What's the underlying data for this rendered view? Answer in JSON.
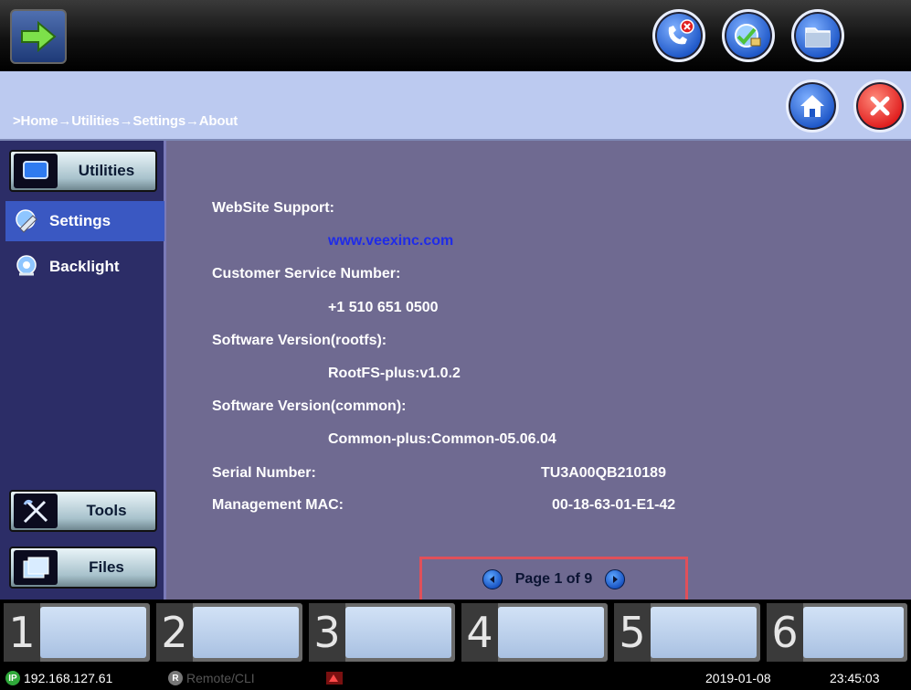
{
  "breadcrumb": ">Home→Utilities→Settings→About",
  "sidebar": {
    "top_button": "Utilities",
    "items": [
      {
        "label": "Settings",
        "active": true
      },
      {
        "label": "Backlight",
        "active": false
      }
    ],
    "bottom_buttons": [
      "Tools",
      "Files"
    ]
  },
  "about": {
    "website_label": "WebSite Support:",
    "website_value": "www.veexinc.com",
    "customer_label": "Customer Service Number:",
    "customer_value": "+1 510 651 0500",
    "rootfs_label": "Software Version(rootfs):",
    "rootfs_value": "RootFS-plus:v1.0.2",
    "common_label": "Software Version(common):",
    "common_value": "Common-plus:Common-05.06.04",
    "serial_label": "Serial Number:",
    "serial_value": "TU3A00QB210189",
    "mac_label": "Management MAC:",
    "mac_value": "00-18-63-01-E1-42"
  },
  "pager": {
    "text": "Page 1 of 9"
  },
  "softkeys": [
    "1",
    "2",
    "3",
    "4",
    "5",
    "6"
  ],
  "status": {
    "ip": "192.168.127.61",
    "remote": "Remote/CLI",
    "date": "2019-01-08",
    "time": "23:45:03"
  },
  "icons": {
    "launcher": "green-arrow-icon",
    "top_right": [
      "phone-disconnect-icon",
      "network-settings-icon",
      "folder-icon"
    ],
    "home": "home-icon",
    "close": "close-icon"
  },
  "colors": {
    "accent_blue": "#1d56c7",
    "close_red": "#e01d1d",
    "content_bg": "#6f6a91",
    "sidebar_bg": "#2c2d67",
    "link": "#1f2be8"
  }
}
